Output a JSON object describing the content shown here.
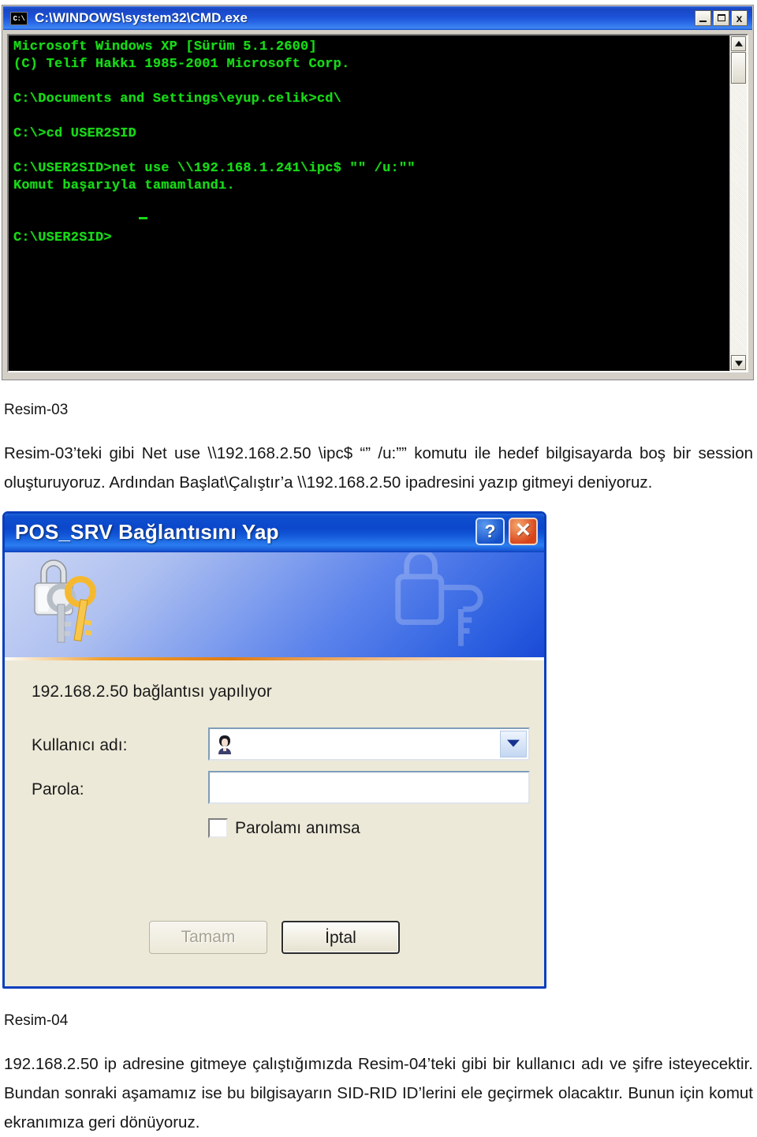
{
  "cmd_window": {
    "title": "C:\\WINDOWS\\system32\\CMD.exe",
    "icon_label": "C:\\",
    "buttons": {
      "minimize": "minimize",
      "maximize": "maximize",
      "close": "x"
    },
    "console_text": "Microsoft Windows XP [Sürüm 5.1.2600]\n(C) Telif Hakkı 1985-2001 Microsoft Corp.\n\nC:\\Documents and Settings\\eyup.celik>cd\\\n\nC:\\>cd USER2SID\n\nC:\\USER2SID>net use \\\\192.168.1.241\\ipc$ \"\" /u:\"\"\nKomut başarıyla tamamlandı.\n\n\nC:\\USER2SID>"
  },
  "caption_1": {
    "label": "Resim-03",
    "paragraph": "Resim-03’teki gibi Net use \\\\192.168.2.50 \\ipc$ “” /u:”” komutu ile hedef bilgisayarda boş bir session oluşturuyoruz. Ardından Başlat\\Çalıştır’a \\\\192.168.2.50 ipadresini yazıp gitmeyi deniyoruz."
  },
  "connect_dialog": {
    "title": "POS_SRV Bağlantısını Yap",
    "help_button": "?",
    "close_button": "✕",
    "status_text": "192.168.2.50 bağlantısı yapılıyor",
    "username_label": "Kullanıcı adı:",
    "username_value": "",
    "password_label": "Parola:",
    "password_value": "",
    "remember_label": "Parolamı anımsa",
    "remember_checked": false,
    "ok_button": "Tamam",
    "ok_disabled": true,
    "cancel_button": "İptal",
    "colors": {
      "titlebar_blue": "#0b47cb",
      "banner_blue": "#2b5fe0",
      "divider_orange": "#e07b12",
      "dialog_face": "#ece9d8",
      "close_red": "#d8441a"
    }
  },
  "caption_2": {
    "label": "Resim-04",
    "paragraph": "192.168.2.50 ip adresine gitmeye çalıştığımızda Resim-04’teki gibi bir kullanıcı adı ve şifre isteyecektir. Bundan sonraki aşamamız ise bu bilgisayarın SID-RID ID’lerini ele geçirmek olacaktır. Bunun için komut ekranımıza geri dönüyoruz."
  }
}
